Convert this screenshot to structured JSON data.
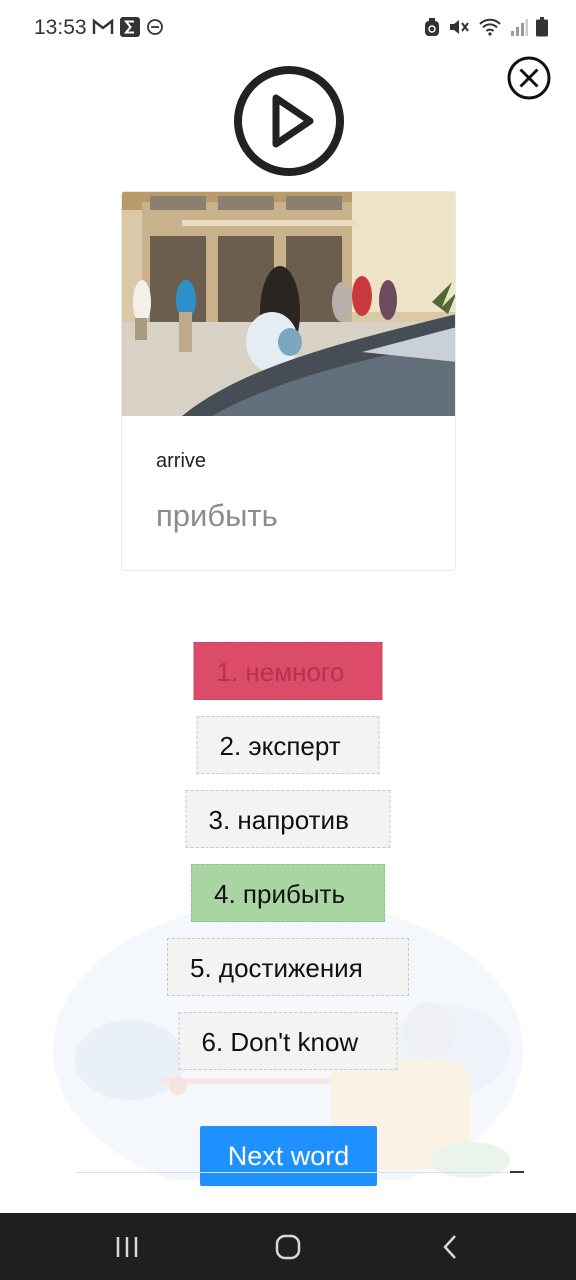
{
  "status_bar": {
    "time": "13:53",
    "left_icons": [
      "gmail-icon",
      "sigma-app-icon",
      "dnd-icon"
    ],
    "right_icons": [
      "alarm-icon",
      "mute-icon",
      "wifi-icon",
      "signal-icon",
      "battery-icon"
    ]
  },
  "card": {
    "image_icon": "photo-students-walking",
    "word": "arrive",
    "translation": "прибыть"
  },
  "options": [
    {
      "label": "1. немного",
      "state": "wrong"
    },
    {
      "label": "2. эксперт",
      "state": "neutral"
    },
    {
      "label": "3. напротив",
      "state": "neutral"
    },
    {
      "label": "4. прибыть",
      "state": "correct"
    },
    {
      "label": "5. достижения",
      "state": "neutral"
    },
    {
      "label": "6. Don't know",
      "state": "neutral"
    }
  ],
  "next_button": {
    "label": "Next word"
  },
  "colors": {
    "wrong": "#dc4b67",
    "correct": "#a8d5a1",
    "neutral": "#f3f3f3",
    "primary": "#1e90ff",
    "nav_bar": "#1f1f1f"
  },
  "nav": [
    "recent-apps-icon",
    "home-icon",
    "back-icon"
  ]
}
